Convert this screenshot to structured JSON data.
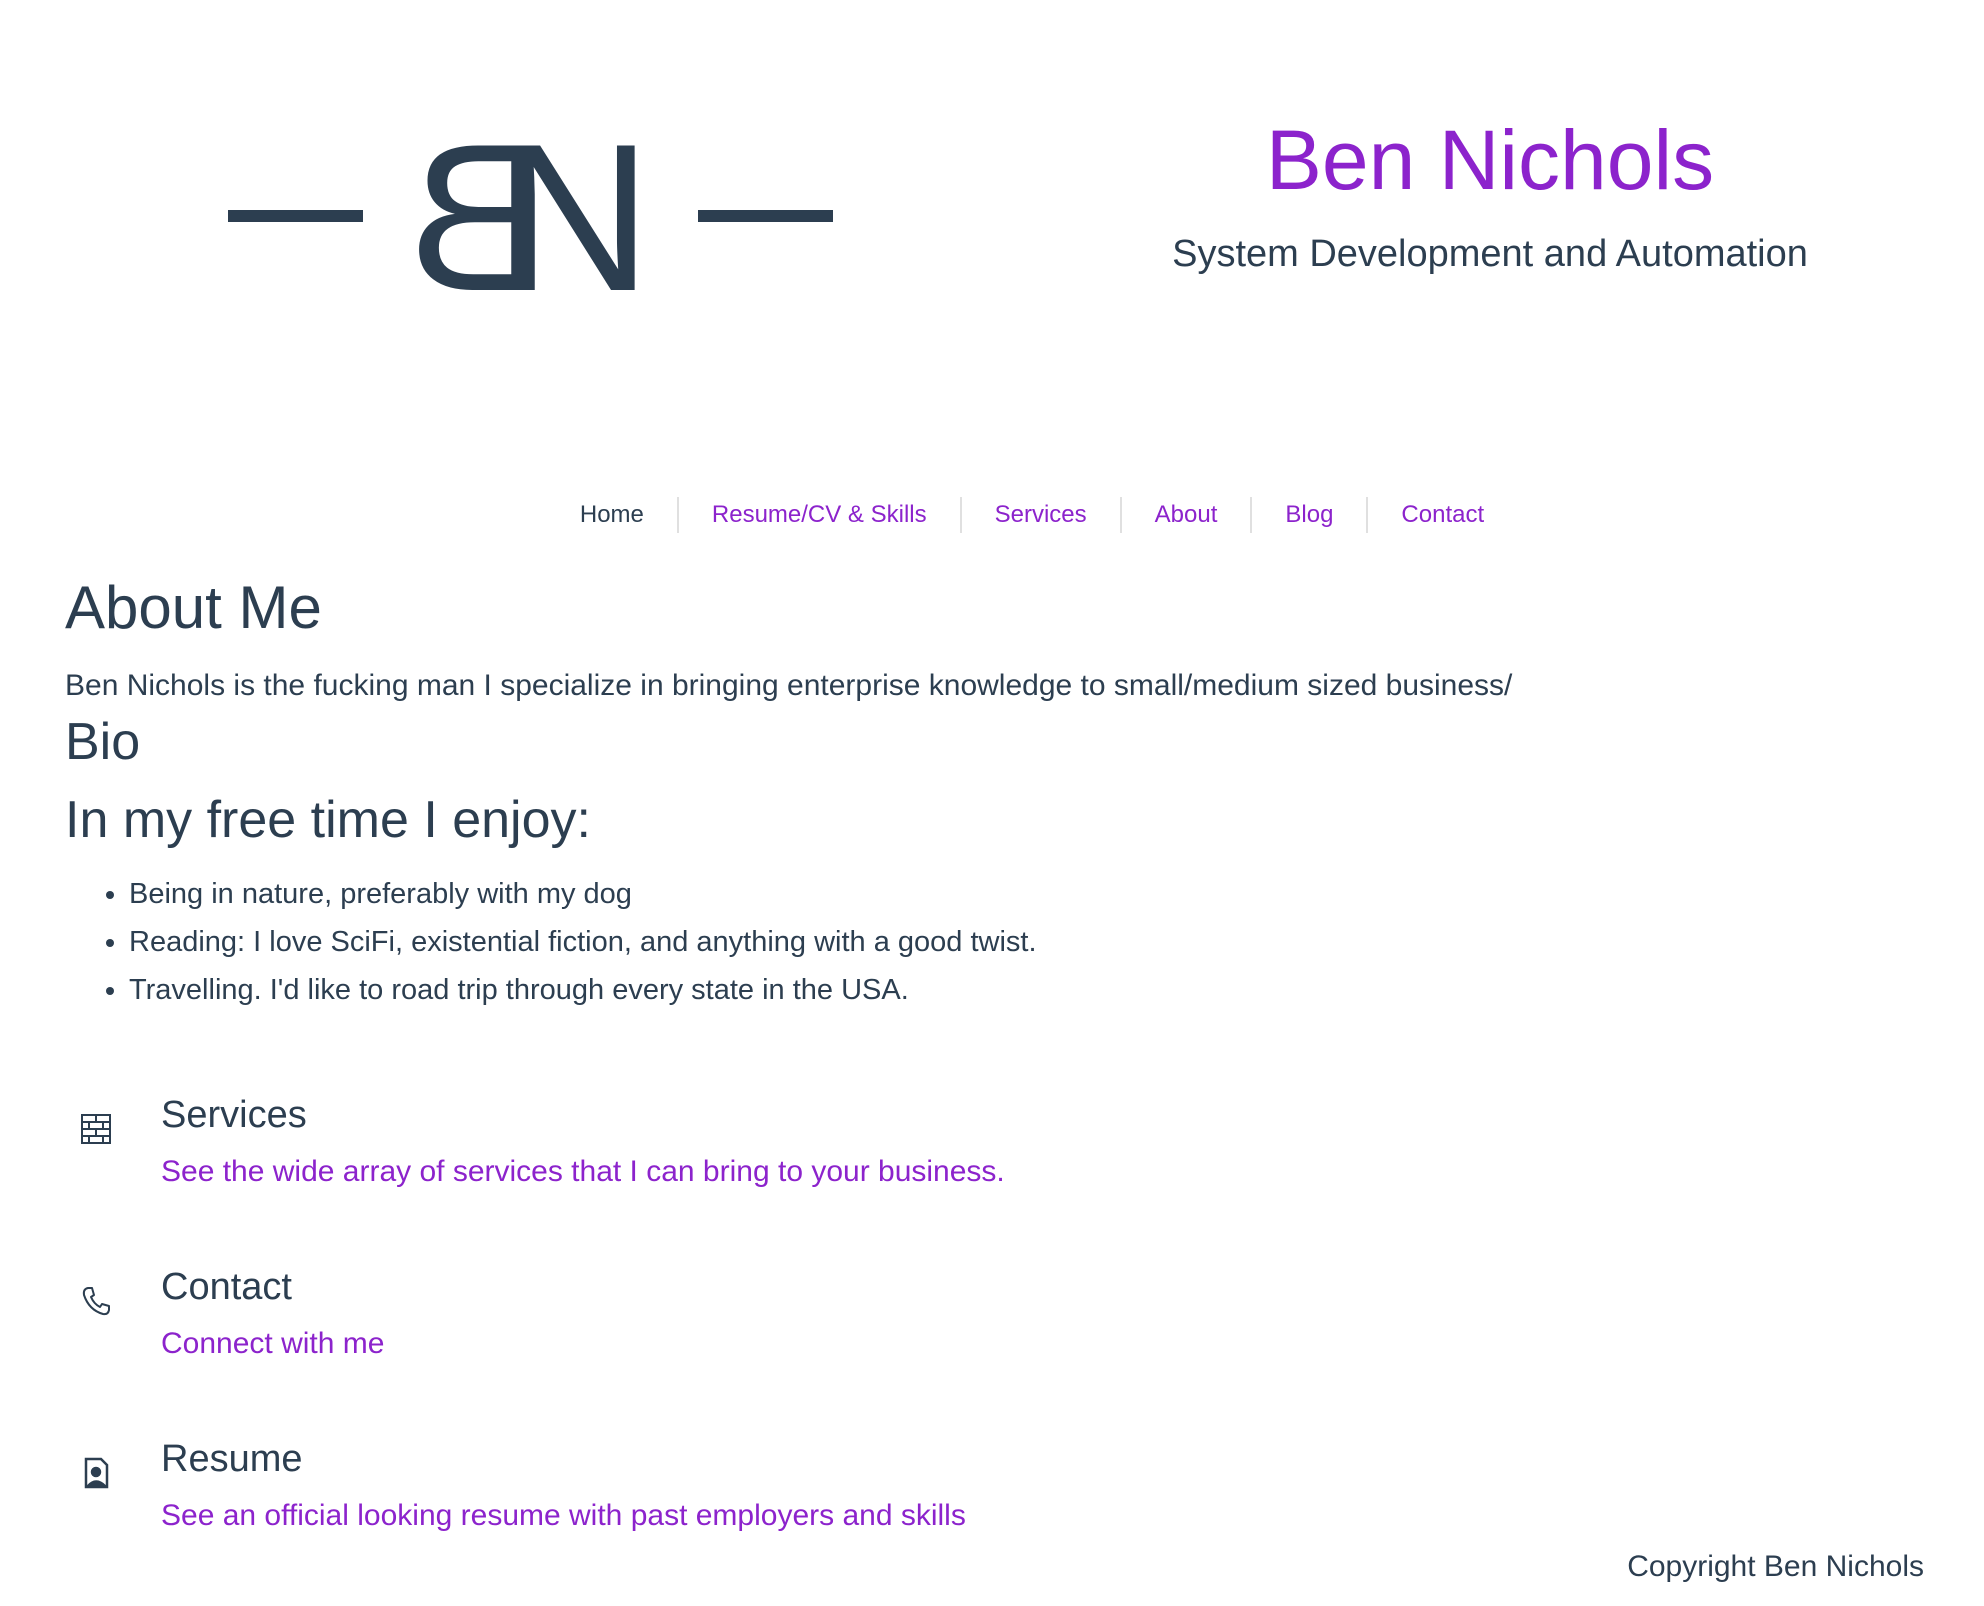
{
  "header": {
    "logo_letter_b": "B",
    "logo_letter_n": "N",
    "name": "Ben Nichols",
    "tagline": "System Development and Automation"
  },
  "nav": {
    "items": [
      {
        "label": "Home",
        "active": true
      },
      {
        "label": "Resume/CV & Skills",
        "active": false
      },
      {
        "label": "Services",
        "active": false
      },
      {
        "label": "About",
        "active": false
      },
      {
        "label": "Blog",
        "active": false
      },
      {
        "label": "Contact",
        "active": false
      }
    ]
  },
  "about": {
    "heading": "About Me",
    "intro": "Ben Nichols is the fucking man I specialize in bringing enterprise knowledge to small/medium sized business/",
    "bio_heading": "Bio",
    "free_time_heading": "In my free time I enjoy:",
    "hobbies": [
      "Being in nature, preferably with my dog",
      "Reading: I love SciFi, existential fiction, and anything with a good twist.",
      "Travelling. I'd like to road trip through every state in the USA."
    ]
  },
  "cards": [
    {
      "icon": "bricks-icon",
      "title": "Services",
      "link": "See the wide array of services that I can bring to your business."
    },
    {
      "icon": "phone-icon",
      "title": "Contact",
      "link": "Connect with me"
    },
    {
      "icon": "person-file-icon",
      "title": "Resume",
      "link": "See an official looking resume with past employers and skills"
    }
  ],
  "footer": {
    "copyright": "Copyright Ben Nichols"
  },
  "colors": {
    "accent": "#8c23cc",
    "text": "#2c3e50",
    "divider": "#e0e0e0",
    "background": "#ffffff"
  }
}
